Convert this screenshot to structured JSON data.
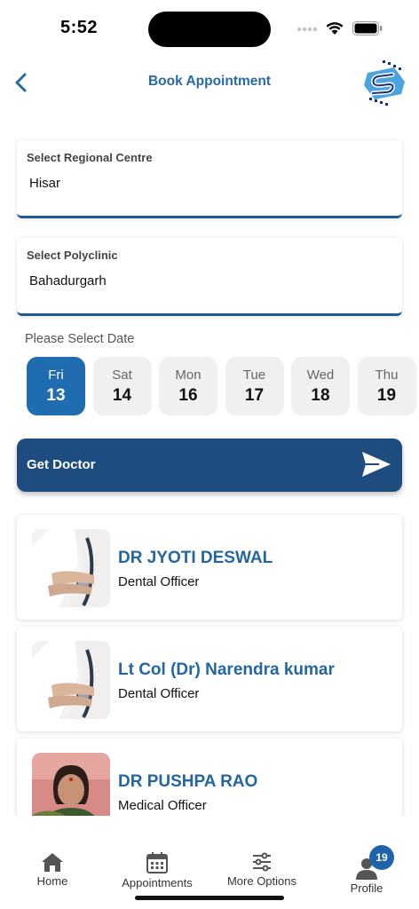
{
  "status_bar": {
    "time": "5:52"
  },
  "header": {
    "title": "Book Appointment"
  },
  "regional_centre": {
    "label": "Select Regional Centre",
    "value": "Hisar"
  },
  "polyclinic": {
    "label": "Select Polyclinic",
    "value": "Bahadurgarh"
  },
  "date_section": {
    "label": "Please Select Date"
  },
  "dates": [
    {
      "dow": "Fri",
      "day": "13",
      "selected": true
    },
    {
      "dow": "Sat",
      "day": "14",
      "selected": false
    },
    {
      "dow": "Mon",
      "day": "16",
      "selected": false
    },
    {
      "dow": "Tue",
      "day": "17",
      "selected": false
    },
    {
      "dow": "Wed",
      "day": "18",
      "selected": false
    },
    {
      "dow": "Thu",
      "day": "19",
      "selected": false
    }
  ],
  "get_doctor": {
    "label": "Get Doctor"
  },
  "doctors": [
    {
      "name": "DR JYOTI DESWAL",
      "role": "Dental Officer"
    },
    {
      "name": "Lt Col (Dr) Narendra kumar",
      "role": "Dental Officer"
    },
    {
      "name": "DR PUSHPA RAO",
      "role": "Medical Officer"
    }
  ],
  "nav": {
    "home": "Home",
    "appointments": "Appointments",
    "more_options": "More Options",
    "profile": "Profile",
    "profile_badge": "19"
  },
  "colors": {
    "accent": "#1f6db0",
    "button": "#1e4c7e",
    "title": "#2a6aa3"
  }
}
